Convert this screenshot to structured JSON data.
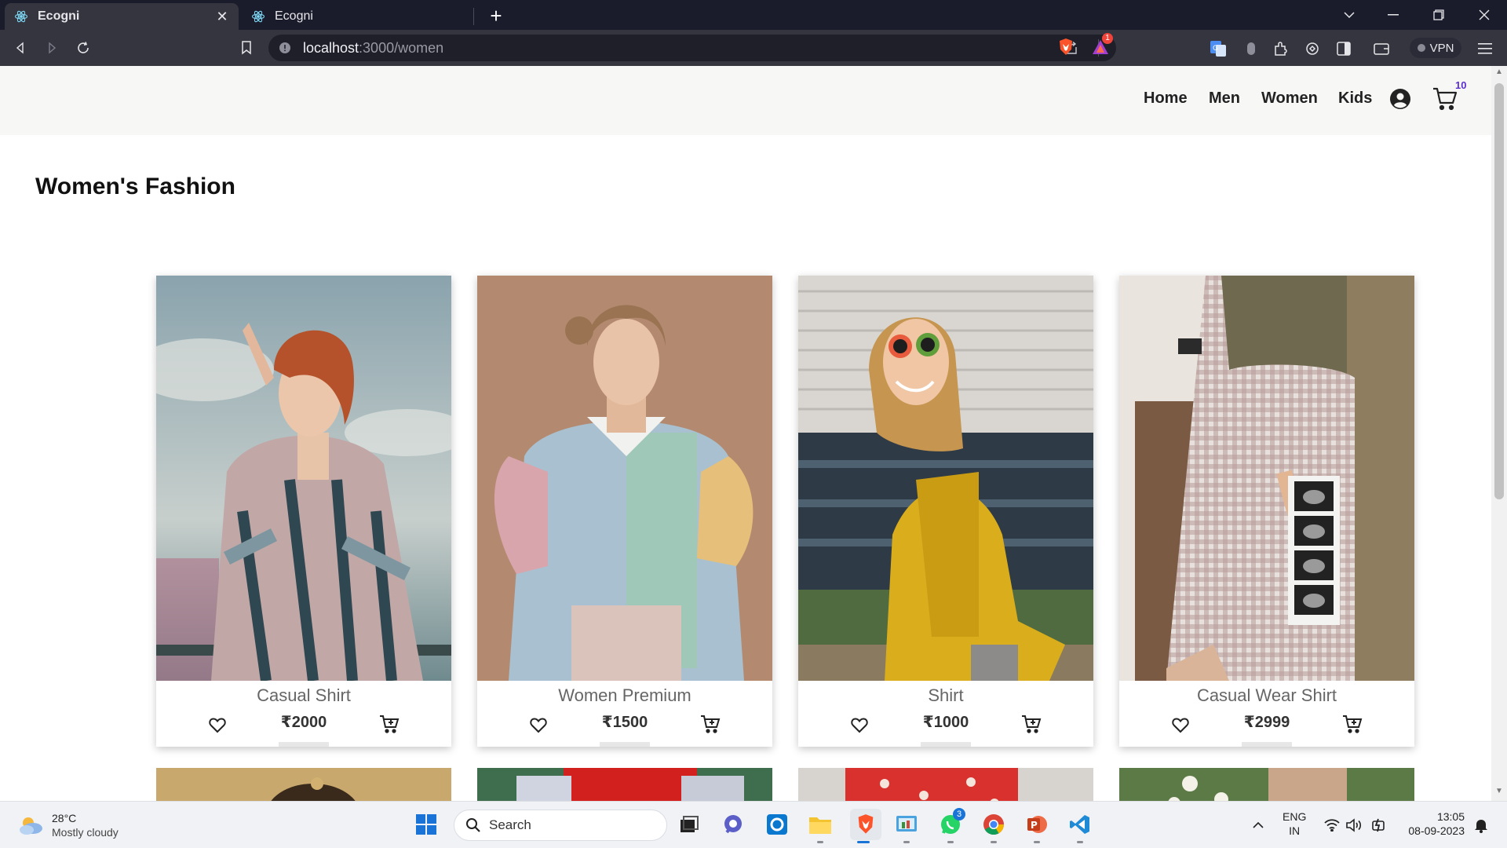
{
  "browser": {
    "tabs": [
      {
        "title": "Ecogni",
        "active": true
      },
      {
        "title": "Ecogni",
        "active": false
      }
    ],
    "url_host": "localhost",
    "url_path": ":3000/women",
    "vpn_label": "VPN",
    "notification_count": "1"
  },
  "site": {
    "nav": [
      "Home",
      "Men",
      "Women",
      "Kids"
    ],
    "cart_count": "10",
    "page_title": "Women's Fashion"
  },
  "products": [
    {
      "name": "Casual Shirt",
      "price": "₹2000"
    },
    {
      "name": "Women Premium",
      "price": "₹1500"
    },
    {
      "name": "Shirt",
      "price": "₹1000"
    },
    {
      "name": "Casual Wear Shirt",
      "price": "₹2999"
    }
  ],
  "taskbar": {
    "weather_temp": "28°C",
    "weather_desc": "Mostly cloudy",
    "search_label": "Search",
    "whatsapp_badge": "3",
    "lang_line1": "ENG",
    "lang_line2": "IN",
    "time": "13:05",
    "date": "08-09-2023"
  },
  "colors": {
    "accent": "#5b2fd1",
    "header_bg": "#f7f7f6",
    "chrome_bg": "#34353f",
    "tabbar_bg": "#1b1c2b"
  }
}
